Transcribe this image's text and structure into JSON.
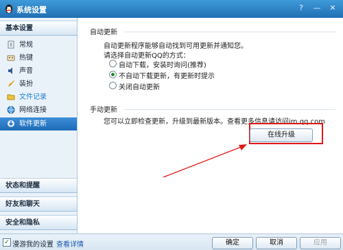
{
  "window": {
    "title": "系统设置"
  },
  "titlebar": {
    "help": "?",
    "minimize": "—",
    "close": "✕"
  },
  "sidebar": {
    "basic": "基本设置",
    "items": [
      {
        "label": "常规",
        "icon": "document-icon"
      },
      {
        "label": "热键",
        "icon": "keyboard-icon"
      },
      {
        "label": "声音",
        "icon": "speaker-icon"
      },
      {
        "label": "装扮",
        "icon": "brush-icon"
      },
      {
        "label": "文件记录",
        "icon": "folder-icon"
      },
      {
        "label": "网络连接",
        "icon": "network-icon"
      },
      {
        "label": "软件更新",
        "icon": "update-icon"
      }
    ],
    "sections": [
      "状态和提醒",
      "好友和聊天",
      "安全和隐私"
    ]
  },
  "auto_update": {
    "title": "自动更新",
    "desc": "自动更新程序能够自动找到可用更新并通知您。",
    "prompt": "请选择自动更新QQ的方式：",
    "options": [
      "自动下载，安装时询问(推荐)",
      "不自动下载更新，有更新时提示",
      "关闭自动更新"
    ],
    "selected_index": 1
  },
  "manual_update": {
    "title": "手动更新",
    "desc": "您可以立即检查更新，升级到最新版本。查看更多信息请访问im.qq.com",
    "button": "在线升级"
  },
  "bottom": {
    "roaming_label": "漫游我的设置",
    "details_link": "查看详情",
    "ok": "确定",
    "cancel": "取消",
    "apply": "应用"
  },
  "colors": {
    "title_bar": "#2a7fc7",
    "active_item": "#2b7cc9",
    "highlight_box": "#e01818",
    "arrow": "#e01818"
  }
}
